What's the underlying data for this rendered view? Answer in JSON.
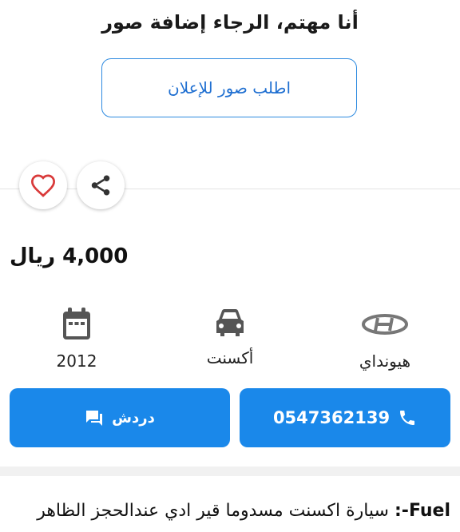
{
  "request_photos": {
    "title": "أنا مهتم، الرجاء إضافة صور",
    "button_label": "اطلب صور للإعلان"
  },
  "listing": {
    "price": "4,000 ريال",
    "specs": {
      "year": "2012",
      "model": "أكسنت",
      "brand": "هيونداي"
    }
  },
  "actions": {
    "chat_label": "دردش",
    "phone_label": "0547362139"
  },
  "description": {
    "key": "Fuel-:",
    "text": " سيارة اكسنت مسدوما قير ادي عندالحجز الظاهر"
  },
  "colors": {
    "accent": "#1a88ea",
    "heart": "#d93a3a"
  },
  "icons": [
    "heart-icon",
    "share-icon",
    "calendar-icon",
    "car-icon",
    "hyundai-logo",
    "chat-icon",
    "phone-icon"
  ]
}
